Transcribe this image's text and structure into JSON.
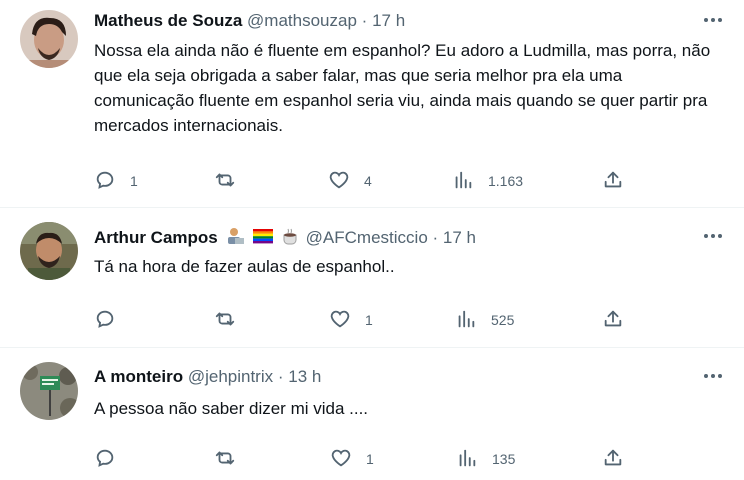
{
  "tweets": [
    {
      "name": "Matheus de Souza",
      "handle": "@mathsouzap",
      "separator": "·",
      "time": "17 h",
      "text": "Nossa ela ainda não é fluente em espanhol? Eu adoro a Ludmilla, mas porra, não que ela seja obrigada a saber falar, mas que seria melhor pra ela uma comunicação fluente em espanhol seria viu, ainda mais quando se quer partir pra mercados internacionais.",
      "replies": "1",
      "retweets": "",
      "likes": "4",
      "views": "1.163"
    },
    {
      "name": "Arthur Campos",
      "name_emojis": [
        "technologist-icon",
        "rainbow-flag-icon",
        "coffee-icon"
      ],
      "handle": "@AFCmesticcio",
      "separator": "·",
      "time": "17 h",
      "text": "Tá na hora de fazer aulas de espanhol..",
      "replies": "",
      "retweets": "",
      "likes": "1",
      "views": "525"
    },
    {
      "name": "A monteiro",
      "handle": "@jehpintrix",
      "separator": "·",
      "time": "13 h",
      "text": "A pessoa não saber dizer mi vida ....",
      "replies": "",
      "retweets": "",
      "likes": "1",
      "views": "135"
    }
  ],
  "colors": {
    "text": "#0f1419",
    "secondary": "#536471",
    "divider": "#eff3f4"
  }
}
